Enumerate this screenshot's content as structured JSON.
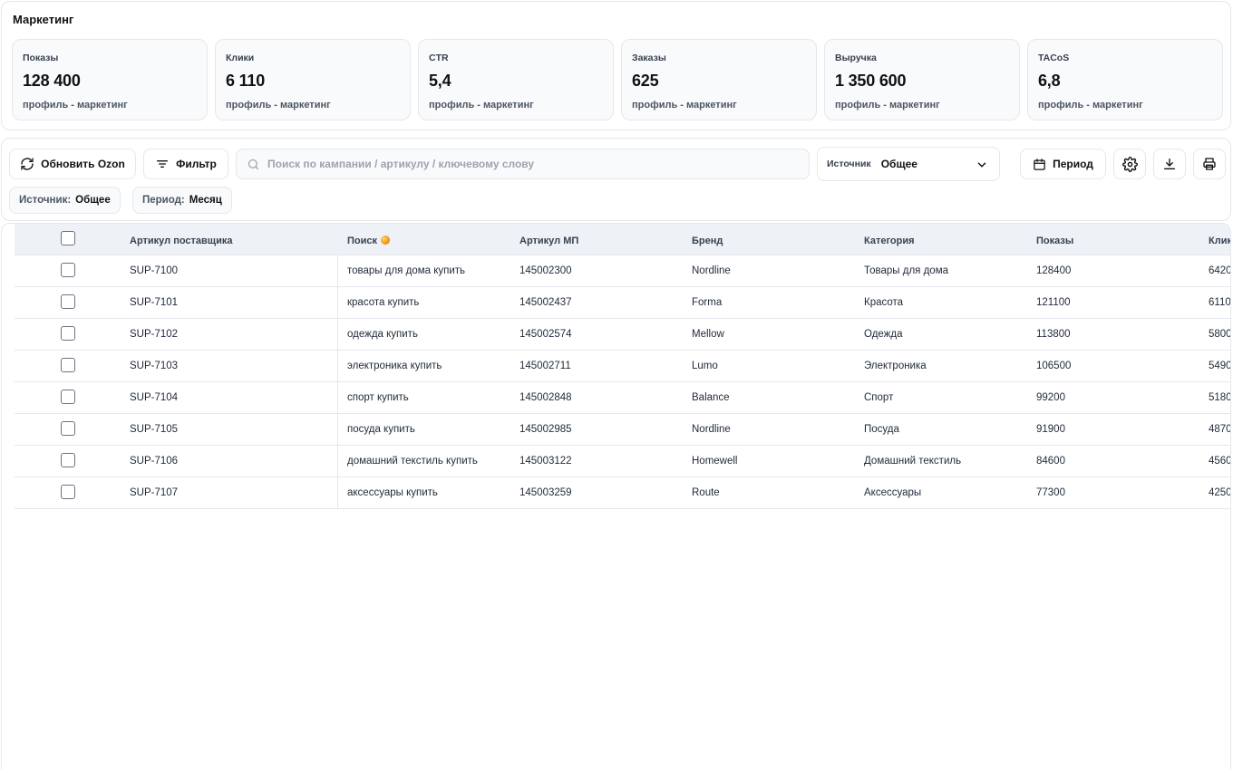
{
  "page": {
    "title": "Маркетинг"
  },
  "kpis": [
    {
      "label": "Показы",
      "value": "128 400",
      "sub": "профиль - маркетинг"
    },
    {
      "label": "Клики",
      "value": "6 110",
      "sub": "профиль - маркетинг"
    },
    {
      "label": "CTR",
      "value": "5,4",
      "sub": "профиль - маркетинг"
    },
    {
      "label": "Заказы",
      "value": "625",
      "sub": "профиль - маркетинг"
    },
    {
      "label": "Выручка",
      "value": "1 350 600",
      "sub": "профиль - маркетинг"
    },
    {
      "label": "TACoS",
      "value": "6,8",
      "sub": "профиль - маркетинг"
    }
  ],
  "toolbar": {
    "refresh_label": "Обновить Ozon",
    "filter_label": "Фильтр",
    "search_placeholder": "Поиск по кампании / артикулу / ключевому слову",
    "search_value": "",
    "source_label": "Источник",
    "source_value": "Общее",
    "period_label": "Период",
    "icons": [
      "refresh-icon",
      "filter-icon",
      "search-icon",
      "chevron-down-icon",
      "calendar-icon",
      "gear-icon",
      "download-icon",
      "printer-icon"
    ]
  },
  "chips": [
    {
      "label": "Источник:",
      "value": "Общее"
    },
    {
      "label": "Период:",
      "value": "Месяц"
    }
  ],
  "table": {
    "columns": [
      "Артикул поставщика",
      "Поиск",
      "Артикул МП",
      "Бренд",
      "Категория",
      "Показы",
      "Клики"
    ],
    "rows": [
      {
        "supplier_sku": "SUP-7100",
        "search": "товары для дома купить",
        "mp_sku": "145002300",
        "brand": "Nordline",
        "category": "Товары для дома",
        "impressions": "128400",
        "clicks": "6420"
      },
      {
        "supplier_sku": "SUP-7101",
        "search": "красота купить",
        "mp_sku": "145002437",
        "brand": "Forma",
        "category": "Красота",
        "impressions": "121100",
        "clicks": "6110"
      },
      {
        "supplier_sku": "SUP-7102",
        "search": "одежда купить",
        "mp_sku": "145002574",
        "brand": "Mellow",
        "category": "Одежда",
        "impressions": "113800",
        "clicks": "5800"
      },
      {
        "supplier_sku": "SUP-7103",
        "search": "электроника купить",
        "mp_sku": "145002711",
        "brand": "Lumo",
        "category": "Электроника",
        "impressions": "106500",
        "clicks": "5490"
      },
      {
        "supplier_sku": "SUP-7104",
        "search": "спорт купить",
        "mp_sku": "145002848",
        "brand": "Balance",
        "category": "Спорт",
        "impressions": "99200",
        "clicks": "5180"
      },
      {
        "supplier_sku": "SUP-7105",
        "search": "посуда купить",
        "mp_sku": "145002985",
        "brand": "Nordline",
        "category": "Посуда",
        "impressions": "91900",
        "clicks": "4870"
      },
      {
        "supplier_sku": "SUP-7106",
        "search": "домашний текстиль купить",
        "mp_sku": "145003122",
        "brand": "Homewell",
        "category": "Домашний текстиль",
        "impressions": "84600",
        "clicks": "4560"
      },
      {
        "supplier_sku": "SUP-7107",
        "search": "аксессуары купить",
        "mp_sku": "145003259",
        "brand": "Route",
        "category": "Аксессуары",
        "impressions": "77300",
        "clicks": "4250"
      }
    ]
  },
  "colors": {
    "accent_dot": "#f59e0b",
    "header_bg": "#eef2f7",
    "border": "#e5e7eb",
    "card_bg": "#f9fafb"
  }
}
